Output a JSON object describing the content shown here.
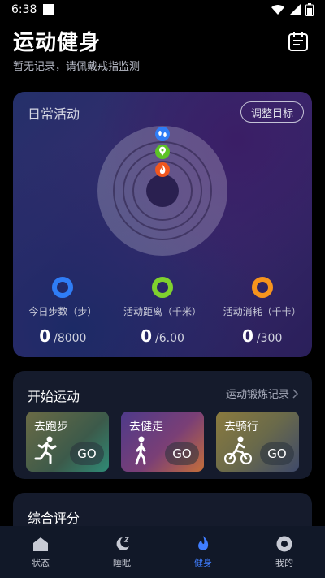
{
  "status_bar": {
    "time": "6:38"
  },
  "header": {
    "title": "运动健身",
    "subtitle": "暂无记录，请佩戴戒指监测"
  },
  "daily": {
    "title": "日常活动",
    "adjust_label": "调整目标",
    "stats": [
      {
        "label": "今日步数（步）",
        "value": "0",
        "goal": "/8000",
        "color": "#2f7df6"
      },
      {
        "label": "活动距离（千米）",
        "value": "0",
        "goal": "/6.00",
        "color": "#7fd12e"
      },
      {
        "label": "活动消耗（千卡）",
        "value": "0",
        "goal": "/300",
        "color": "#f7941d"
      }
    ],
    "ring_icons": [
      "footsteps-icon",
      "location-pin-icon",
      "flame-icon"
    ]
  },
  "start": {
    "title": "开始运动",
    "record_link": "运动锻炼记录",
    "tiles": [
      {
        "label": "去跑步",
        "go": "GO",
        "icon": "running-person-icon"
      },
      {
        "label": "去健走",
        "go": "GO",
        "icon": "walking-person-icon"
      },
      {
        "label": "去骑行",
        "go": "GO",
        "icon": "cycling-person-icon"
      }
    ]
  },
  "score": {
    "title": "综合评分"
  },
  "nav": [
    {
      "label": "状态",
      "icon": "house-icon"
    },
    {
      "label": "睡眠",
      "icon": "moon-zzz-icon"
    },
    {
      "label": "健身",
      "icon": "flame-icon",
      "active": true
    },
    {
      "label": "我的",
      "icon": "profile-icon"
    }
  ],
  "colors": {
    "accent": "#3f7dff",
    "card": "#151b2c",
    "steps": "#2f7df6",
    "distance": "#7fd12e",
    "calories": "#f7941d"
  }
}
